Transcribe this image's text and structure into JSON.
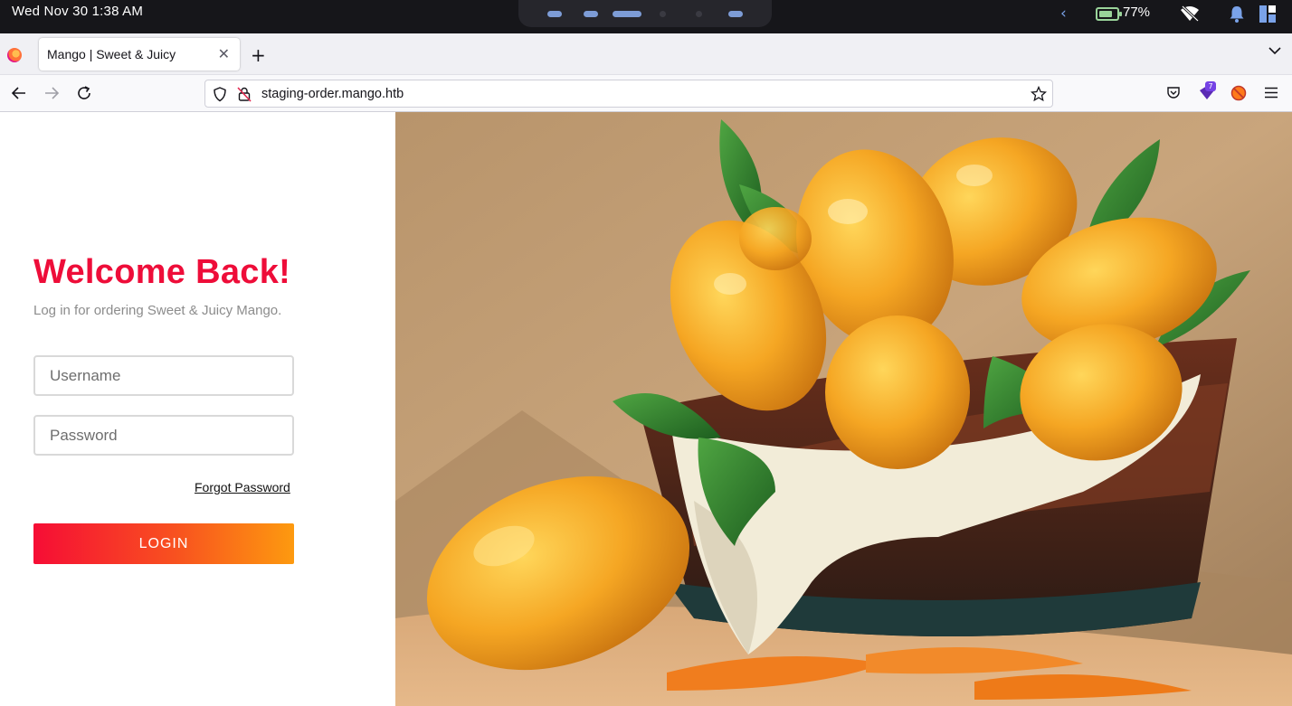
{
  "os": {
    "datetime": "Wed Nov 30   1:38 AM",
    "battery_percent": "77%",
    "battery_level": 0.77
  },
  "browser": {
    "tab_title": "Mango | Sweet & Juicy",
    "url": "staging-order.mango.htb",
    "extension_badge": "7"
  },
  "login": {
    "heading": "Welcome Back!",
    "subtitle": "Log in for ordering Sweet & Juicy Mango.",
    "username_placeholder": "Username",
    "password_placeholder": "Password",
    "forgot_label": "Forgot Password",
    "login_label": "LOGIN"
  },
  "colors": {
    "heading": "#ee0d39",
    "button_gradient_start": "#f60d35",
    "button_gradient_end": "#fd9a0f"
  }
}
